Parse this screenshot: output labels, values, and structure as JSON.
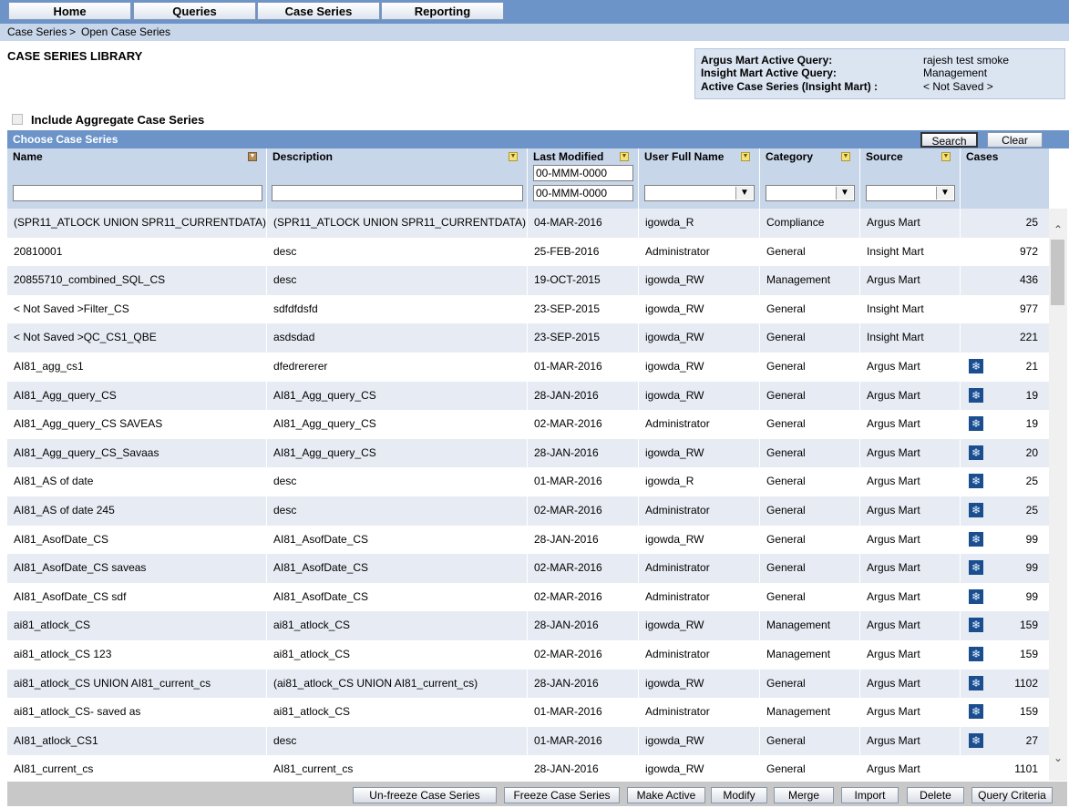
{
  "nav": [
    {
      "label": "Home"
    },
    {
      "label": "Queries"
    },
    {
      "label": "Case Series"
    },
    {
      "label": "Reporting"
    }
  ],
  "breadcrumb": {
    "item1": "Case Series",
    "separator": ">",
    "item2": "Open Case Series"
  },
  "page_title": "CASE SERIES LIBRARY",
  "info": {
    "argus_label": "Argus Mart Active Query:",
    "argus_value": "rajesh test smoke",
    "insight_label": "Insight Mart Active Query:",
    "insight_value": "Management",
    "active_label": "Active Case Series (Insight Mart) :",
    "active_value": "< Not Saved >"
  },
  "include_aggregate_label": "Include Aggregate Case Series",
  "panel_title": "Choose Case Series",
  "search_label": "Search",
  "clear_label": "Clear",
  "columns": {
    "name": "Name",
    "description": "Description",
    "last_modified": "Last Modified",
    "user": "User Full Name",
    "category": "Category",
    "source": "Source",
    "cases": "Cases"
  },
  "filters": {
    "date_from": "00-MMM-0000",
    "date_to": "00-MMM-0000"
  },
  "rows": [
    {
      "name": "(SPR11_ATLOCK UNION SPR11_CURRENTDATA)",
      "desc": "(SPR11_ATLOCK UNION SPR11_CURRENTDATA)",
      "date": "04-MAR-2016",
      "user": "igowda_R",
      "cat": "Compliance",
      "src": "Argus Mart",
      "agg": false,
      "cases": "25"
    },
    {
      "name": "20810001",
      "desc": "desc",
      "date": "25-FEB-2016",
      "user": "Administrator",
      "cat": "General",
      "src": "Insight Mart",
      "agg": false,
      "cases": "972"
    },
    {
      "name": "20855710_combined_SQL_CS",
      "desc": "desc",
      "date": "19-OCT-2015",
      "user": "igowda_RW",
      "cat": "Management",
      "src": "Argus Mart",
      "agg": false,
      "cases": "436"
    },
    {
      "name": "< Not Saved >Filter_CS",
      "desc": "sdfdfdsfd",
      "date": "23-SEP-2015",
      "user": "igowda_RW",
      "cat": "General",
      "src": "Insight Mart",
      "agg": false,
      "cases": "977"
    },
    {
      "name": "< Not Saved >QC_CS1_QBE",
      "desc": "asdsdad",
      "date": "23-SEP-2015",
      "user": "igowda_RW",
      "cat": "General",
      "src": "Insight Mart",
      "agg": false,
      "cases": "221"
    },
    {
      "name": "AI81_agg_cs1",
      "desc": "dfedrererer",
      "date": "01-MAR-2016",
      "user": "igowda_RW",
      "cat": "General",
      "src": "Argus Mart",
      "agg": true,
      "cases": "21"
    },
    {
      "name": "AI81_Agg_query_CS",
      "desc": "AI81_Agg_query_CS",
      "date": "28-JAN-2016",
      "user": "igowda_RW",
      "cat": "General",
      "src": "Argus Mart",
      "agg": true,
      "cases": "19"
    },
    {
      "name": "AI81_Agg_query_CS SAVEAS",
      "desc": "AI81_Agg_query_CS",
      "date": "02-MAR-2016",
      "user": "Administrator",
      "cat": "General",
      "src": "Argus Mart",
      "agg": true,
      "cases": "19"
    },
    {
      "name": "AI81_Agg_query_CS_Savaas",
      "desc": "AI81_Agg_query_CS",
      "date": "28-JAN-2016",
      "user": "igowda_RW",
      "cat": "General",
      "src": "Argus Mart",
      "agg": true,
      "cases": "20"
    },
    {
      "name": "AI81_AS of date",
      "desc": "desc",
      "date": "01-MAR-2016",
      "user": "igowda_R",
      "cat": "General",
      "src": "Argus Mart",
      "agg": true,
      "cases": "25"
    },
    {
      "name": "AI81_AS of date 245",
      "desc": "desc",
      "date": "02-MAR-2016",
      "user": "Administrator",
      "cat": "General",
      "src": "Argus Mart",
      "agg": true,
      "cases": "25"
    },
    {
      "name": "AI81_AsofDate_CS",
      "desc": "AI81_AsofDate_CS",
      "date": "28-JAN-2016",
      "user": "igowda_RW",
      "cat": "General",
      "src": "Argus Mart",
      "agg": true,
      "cases": "99"
    },
    {
      "name": "AI81_AsofDate_CS saveas",
      "desc": "AI81_AsofDate_CS",
      "date": "02-MAR-2016",
      "user": "Administrator",
      "cat": "General",
      "src": "Argus Mart",
      "agg": true,
      "cases": "99"
    },
    {
      "name": "AI81_AsofDate_CS sdf",
      "desc": "AI81_AsofDate_CS",
      "date": "02-MAR-2016",
      "user": "Administrator",
      "cat": "General",
      "src": "Argus Mart",
      "agg": true,
      "cases": "99"
    },
    {
      "name": "ai81_atlock_CS",
      "desc": "ai81_atlock_CS",
      "date": "28-JAN-2016",
      "user": "igowda_RW",
      "cat": "Management",
      "src": "Argus Mart",
      "agg": true,
      "cases": "159"
    },
    {
      "name": "ai81_atlock_CS 123",
      "desc": "ai81_atlock_CS",
      "date": "02-MAR-2016",
      "user": "Administrator",
      "cat": "Management",
      "src": "Argus Mart",
      "agg": true,
      "cases": "159"
    },
    {
      "name": "ai81_atlock_CS UNION AI81_current_cs",
      "desc": "(ai81_atlock_CS UNION AI81_current_cs)",
      "date": "28-JAN-2016",
      "user": "igowda_RW",
      "cat": "General",
      "src": "Argus Mart",
      "agg": true,
      "cases": "1102"
    },
    {
      "name": "ai81_atlock_CS- saved as",
      "desc": "ai81_atlock_CS",
      "date": "01-MAR-2016",
      "user": "Administrator",
      "cat": "Management",
      "src": "Argus Mart",
      "agg": true,
      "cases": "159"
    },
    {
      "name": "AI81_atlock_CS1",
      "desc": "desc",
      "date": "01-MAR-2016",
      "user": "igowda_RW",
      "cat": "General",
      "src": "Argus Mart",
      "agg": true,
      "cases": "27"
    },
    {
      "name": "AI81_current_cs",
      "desc": "AI81_current_cs",
      "date": "28-JAN-2016",
      "user": "igowda_RW",
      "cat": "General",
      "src": "Argus Mart",
      "agg": false,
      "cases": "1101"
    }
  ],
  "bottom_buttons": [
    {
      "label": "Un-freeze Case Series"
    },
    {
      "label": "Freeze Case Series"
    },
    {
      "label": "Make Active"
    },
    {
      "label": "Modify"
    },
    {
      "label": "Merge"
    },
    {
      "label": "Import"
    },
    {
      "label": "Delete"
    },
    {
      "label": "Query Criteria"
    }
  ],
  "icons": {
    "aggregate": "snowflake-aggregate-icon",
    "sort": "sort-arrow-icon"
  }
}
